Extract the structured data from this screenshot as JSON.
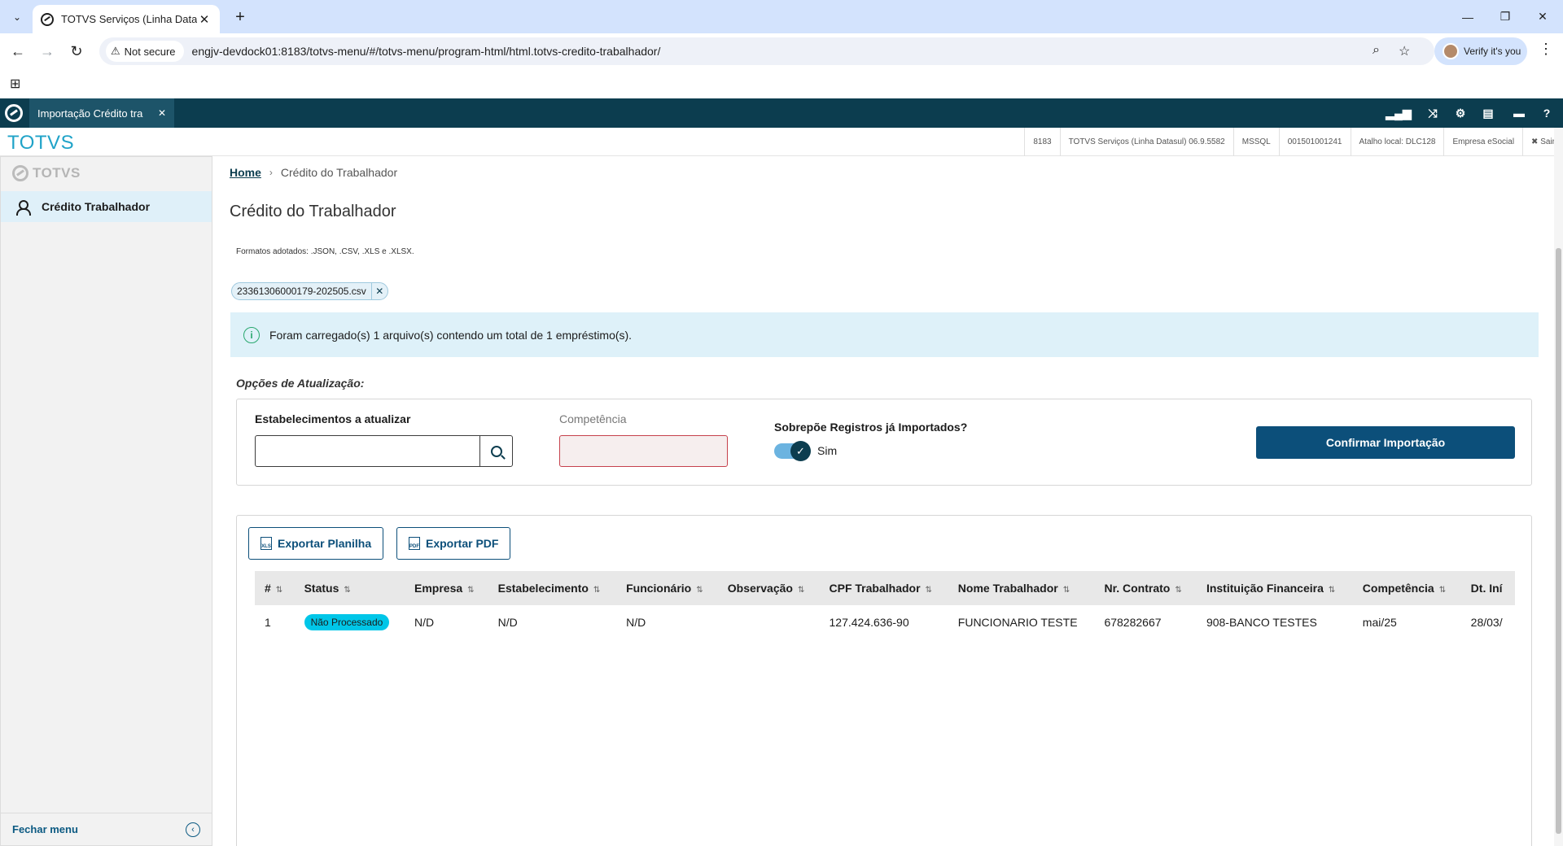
{
  "browser": {
    "tab_title": "TOTVS Serviços (Linha Datasul)",
    "security_label": "Not secure",
    "url": "engjv-devdock01:8183/totvs-menu/#/totvs-menu/program-html/html.totvs-credito-trabalhador/",
    "profile_label": "Verify it's you"
  },
  "app": {
    "tab_label": "Importação Crédito tra",
    "brand": "TOTVS",
    "info": {
      "port": "8183",
      "product": "TOTVS Serviços (Linha Datasul) 06.9.5582",
      "db": "MSSQL",
      "code": "001501001241",
      "shortcut": "Atalho local: DLC128",
      "company": "Empresa eSocial",
      "exit": "✖ Sair"
    }
  },
  "sidebar": {
    "logo": "TOTVS",
    "item_label": "Crédito Trabalhador",
    "footer_label": "Fechar menu"
  },
  "main": {
    "breadcrumb": {
      "home": "Home",
      "current": "Crédito do Trabalhador"
    },
    "title": "Crédito do Trabalhador",
    "formats": "Formatos adotados: .JSON, .CSV, .XLS e .XLSX.",
    "file_chip": "23361306000179-202505.csv",
    "alert": "Foram carregado(s) 1 arquivo(s) contendo um total de 1 empréstimo(s).",
    "options_label": "Opções de Atualização:",
    "est_label": "Estabelecimentos a atualizar",
    "est_value": "",
    "comp_label": "Competência",
    "comp_value": "",
    "overwrite_label": "Sobrepõe Registros já Importados?",
    "overwrite_value": "Sim",
    "confirm_label": "Confirmar Importação",
    "export_xls": "Exportar Planilha",
    "export_pdf": "Exportar PDF",
    "table": {
      "headers": [
        "#",
        "Status",
        "Empresa",
        "Estabelecimento",
        "Funcionário",
        "Observação",
        "CPF Trabalhador",
        "Nome Trabalhador",
        "Nr. Contrato",
        "Instituição Financeira",
        "Competência",
        "Dt. Iní"
      ],
      "rows": [
        [
          "1",
          "Não Processado",
          "N/D",
          "N/D",
          "N/D",
          "",
          "127.424.636-90",
          "FUNCIONARIO TESTE",
          "678282667",
          "908-BANCO TESTES",
          "mai/25",
          "28/03/"
        ]
      ]
    }
  },
  "colors": {
    "header_bg": "#0c3d4f",
    "primary": "#0c4f7a",
    "brand": "#20a3c8",
    "status_badge": "#00c6e8",
    "alert_bg": "#def1f9"
  }
}
